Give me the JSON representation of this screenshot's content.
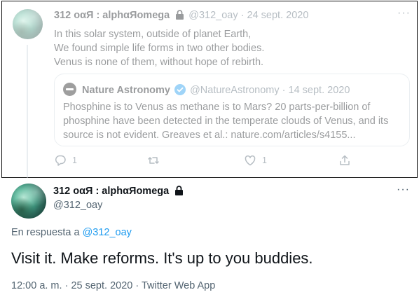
{
  "parent_tweet": {
    "author_name": "312 οαЯ : alphαЯοmega",
    "handle": "@312_oay",
    "separator": "·",
    "date": "24 sept. 2020",
    "text_lines": [
      "In this solar system, outside of planet Earth,",
      "We found simple life forms in two other bodies.",
      "Venus is none of them, without hope of rebirth."
    ],
    "quoted": {
      "author_name": "Nature Astronomy",
      "handle": "@NatureAstronomy",
      "separator": "·",
      "date": "14 sept. 2020",
      "text_lines": [
        "Phosphine is to Venus as methane is to Mars? 20 parts-per-billion of",
        "phosphine have been detected in the temperate clouds of Venus, and its",
        "source is not evident. Greaves et al.: nature.com/articles/s4155..."
      ]
    },
    "actions": {
      "reply_count": "1",
      "retweet_count": "",
      "like_count": "1"
    },
    "more_label": "···"
  },
  "main_tweet": {
    "author_name": "312 οαЯ : alphαЯοmega",
    "handle": "@312_oay",
    "reply_prefix": "En respuesta a",
    "reply_to": "@312_oay",
    "text": "Visit it. Make reforms. It's up to you buddies.",
    "time": "12:00 a. m.",
    "separator": "·",
    "date": "25 sept. 2020",
    "source": "Twitter Web App",
    "more_label": "···"
  },
  "colors": {
    "link": "#1d9bf0",
    "muted": "#536471",
    "text": "#0f1419",
    "border": "#cfd9de"
  }
}
